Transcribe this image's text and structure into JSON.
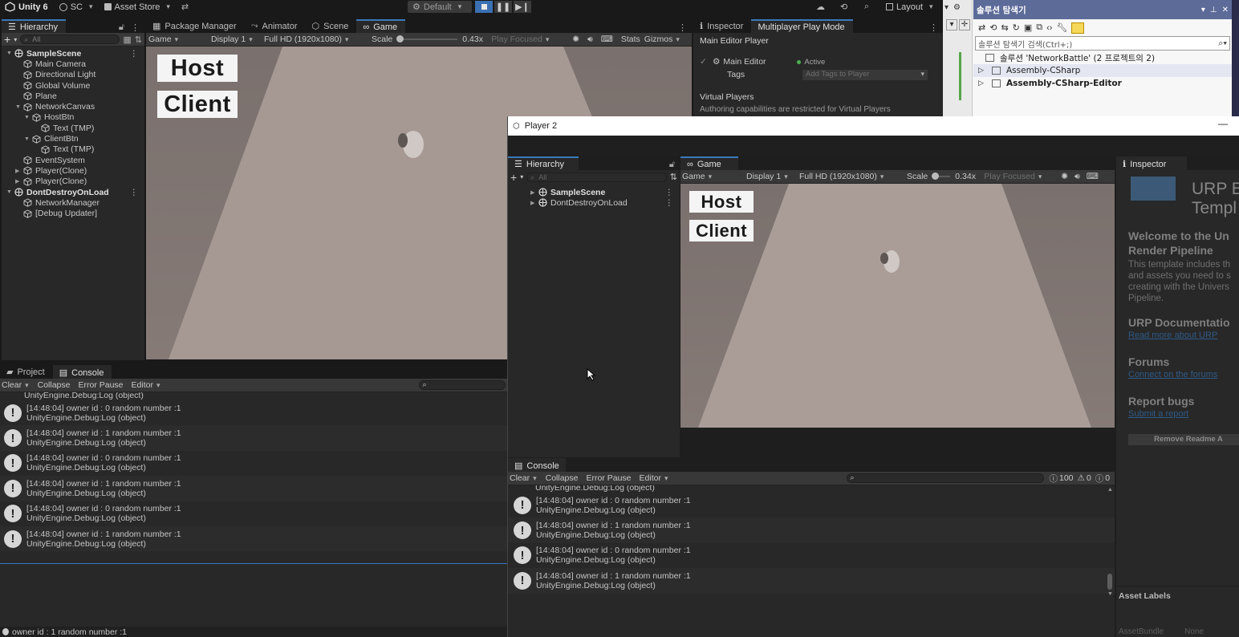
{
  "topbar": {
    "app_name": "Unity 6",
    "account": "SC",
    "asset_store": "Asset Store",
    "layout_mode": "Default",
    "layout": "Layout"
  },
  "main": {
    "hierarchy": {
      "tab": "Hierarchy",
      "search_placeholder": "All",
      "items": [
        {
          "label": "SampleScene",
          "depth": 0,
          "type": "scene",
          "arrow": "down"
        },
        {
          "label": "Main Camera",
          "depth": 1,
          "type": "obj",
          "arrow": ""
        },
        {
          "label": "Directional Light",
          "depth": 1,
          "type": "obj",
          "arrow": ""
        },
        {
          "label": "Global Volume",
          "depth": 1,
          "type": "obj",
          "arrow": ""
        },
        {
          "label": "Plane",
          "depth": 1,
          "type": "obj",
          "arrow": ""
        },
        {
          "label": "NetworkCanvas",
          "depth": 1,
          "type": "obj",
          "arrow": "down"
        },
        {
          "label": "HostBtn",
          "depth": 2,
          "type": "obj",
          "arrow": "down"
        },
        {
          "label": "Text (TMP)",
          "depth": 3,
          "type": "obj",
          "arrow": ""
        },
        {
          "label": "ClientBtn",
          "depth": 2,
          "type": "obj",
          "arrow": "down"
        },
        {
          "label": "Text (TMP)",
          "depth": 3,
          "type": "obj",
          "arrow": ""
        },
        {
          "label": "EventSystem",
          "depth": 1,
          "type": "obj",
          "arrow": ""
        },
        {
          "label": "Player(Clone)",
          "depth": 1,
          "type": "obj",
          "arrow": "right"
        },
        {
          "label": "Player(Clone)",
          "depth": 1,
          "type": "obj",
          "arrow": "right"
        },
        {
          "label": "DontDestroyOnLoad",
          "depth": 0,
          "type": "scene",
          "arrow": "down"
        },
        {
          "label": "NetworkManager",
          "depth": 1,
          "type": "obj",
          "arrow": ""
        },
        {
          "label": "[Debug Updater]",
          "depth": 1,
          "type": "obj",
          "arrow": ""
        }
      ]
    },
    "center_tabs": [
      "Package Manager",
      "Animator",
      "Scene",
      "Game"
    ],
    "game_toolbar": {
      "view": "Game",
      "display": "Display 1",
      "resolution": "Full HD (1920x1080)",
      "scale_label": "Scale",
      "scale_value": "0.43x",
      "play_focus": "Play Focused",
      "stats": "Stats",
      "gizmos": "Gizmos"
    },
    "game_buttons": {
      "host": "Host",
      "client": "Client"
    },
    "inspector": {
      "tabs": [
        "Inspector",
        "Multiplayer Play Mode"
      ],
      "section": "Main Editor Player",
      "main_editor": "Main Editor",
      "status": "Active",
      "tags_label": "Tags",
      "tags_placeholder": "Add Tags to Player",
      "virtual_players": "Virtual Players",
      "virtual_note": "Authoring capabilities are restricted for Virtual Players"
    },
    "bottom_tabs": [
      "Project",
      "Console"
    ],
    "console_toolbar": {
      "clear": "Clear",
      "collapse": "Collapse",
      "error_pause": "Error Pause",
      "editor": "Editor"
    },
    "console_top_partial": "UnityEngine.Debug:Log (object)",
    "console_logs": [
      {
        "msg": "[14:48:04] owner id : 0 random number :1",
        "sub": "UnityEngine.Debug:Log (object)"
      },
      {
        "msg": "[14:48:04] owner id : 1 random number :1",
        "sub": "UnityEngine.Debug:Log (object)"
      },
      {
        "msg": "[14:48:04] owner id : 0 random number :1",
        "sub": "UnityEngine.Debug:Log (object)"
      },
      {
        "msg": "[14:48:04] owner id : 1 random number :1",
        "sub": "UnityEngine.Debug:Log (object)"
      },
      {
        "msg": "[14:48:04] owner id : 0 random number :1",
        "sub": "UnityEngine.Debug:Log (object)"
      },
      {
        "msg": "[14:48:04] owner id : 1 random number :1",
        "sub": "UnityEngine.Debug:Log (object)"
      }
    ],
    "status_bar": "owner id : 1 random number :1"
  },
  "vs": {
    "title": "솔루션 탐색기",
    "search_placeholder": "솔루션 탐색기 검색(Ctrl+;)",
    "items": [
      {
        "label": "솔루션 'NetworkBattle' (2 프로젝트의 2)",
        "arrow": ""
      },
      {
        "label": "Assembly-CSharp",
        "arrow": "▷"
      },
      {
        "label": "Assembly-CSharp-Editor",
        "arrow": "▷"
      }
    ]
  },
  "player2": {
    "title": "Player 2",
    "hierarchy_tab": "Hierarchy",
    "search_placeholder": "All",
    "scenes": [
      "SampleScene",
      "DontDestroyOnLoad"
    ],
    "game_tab": "Game",
    "game_toolbar": {
      "view": "Game",
      "display": "Display 1",
      "resolution": "Full HD (1920x1080)",
      "scale_label": "Scale",
      "scale_value": "0.34x",
      "play_focus": "Play Focused"
    },
    "game_buttons": {
      "host": "Host",
      "client": "Client"
    },
    "inspector": {
      "tab": "Inspector",
      "title_line1": "URP E",
      "title_line2": "Templ",
      "welcome_h1": "Welcome to the Un",
      "welcome_h2": "Render Pipeline",
      "welcome_body": [
        "This template includes th",
        "and assets you need to s",
        "creating with the Univers",
        "Pipeline."
      ],
      "doc_h": "URP Documentatio",
      "doc_link": "Read more about URP",
      "forums_h": "Forums",
      "forums_link": "Connect on the forums",
      "bugs_h": "Report bugs",
      "bugs_link": "Submit a report",
      "remove_btn": "Remove Readme A",
      "asset_labels": "Asset Labels",
      "asset_bundle": "AssetBundle",
      "asset_bundle_value": "None"
    },
    "console_tab": "Console",
    "console_toolbar": {
      "clear": "Clear",
      "collapse": "Collapse",
      "error_pause": "Error Pause",
      "editor": "Editor"
    },
    "counts": {
      "logs": "100",
      "warnings": "0",
      "errors": "0"
    },
    "console_top_partial": "UnityEngine.Debug:Log (object)",
    "console_logs": [
      {
        "msg": "[14:48:04] owner id : 0 random number :1",
        "sub": "UnityEngine.Debug:Log (object)"
      },
      {
        "msg": "[14:48:04] owner id : 1 random number :1",
        "sub": "UnityEngine.Debug:Log (object)"
      },
      {
        "msg": "[14:48:04] owner id : 0 random number :1",
        "sub": "UnityEngine.Debug:Log (object)"
      },
      {
        "msg": "[14:48:04] owner id : 1 random number :1",
        "sub": "UnityEngine.Debug:Log (object)"
      }
    ]
  },
  "colors": {
    "accent": "#3a79bb",
    "active_dot": "#4caf50",
    "link": "#4a90d9"
  }
}
